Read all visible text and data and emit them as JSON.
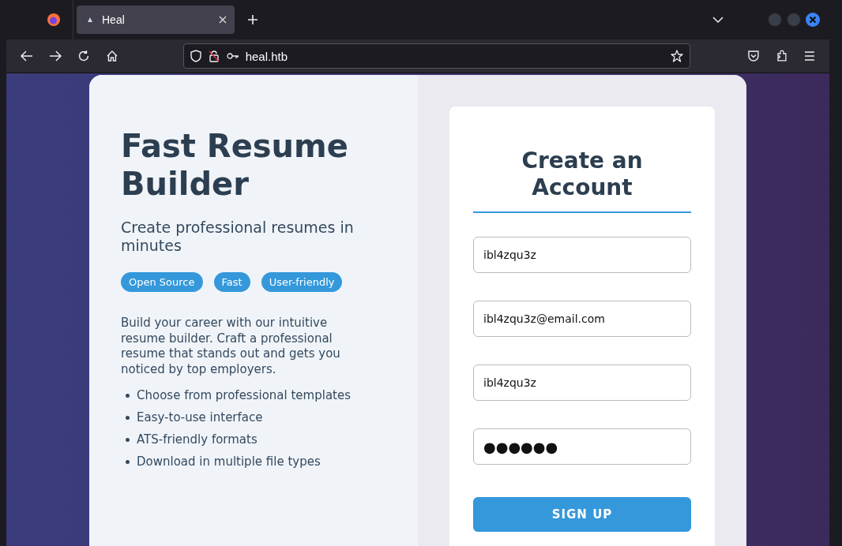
{
  "browser": {
    "tab": {
      "title": "Heal",
      "selected": true
    },
    "address": "heal.htb"
  },
  "hero": {
    "title": "Fast Resume Builder",
    "subtitle": "Create professional resumes in minutes",
    "tags": [
      "Open Source",
      "Fast",
      "User-friendly"
    ],
    "description": "Build your career with our intuitive resume builder. Craft a professional resume that stands out and gets you noticed by top employers.",
    "features": [
      "Choose from professional templates",
      "Easy-to-use interface",
      "ATS-friendly formats",
      "Download in multiple file types"
    ]
  },
  "form": {
    "title": "Create an Account",
    "fields": [
      {
        "kind": "text",
        "value": "ibl4zqu3z"
      },
      {
        "kind": "email",
        "value": "ibl4zqu3z@email.com"
      },
      {
        "kind": "text",
        "value": "ibl4zqu3z"
      },
      {
        "kind": "password",
        "value": "●●●●●●"
      }
    ],
    "button": "SIGN UP"
  }
}
